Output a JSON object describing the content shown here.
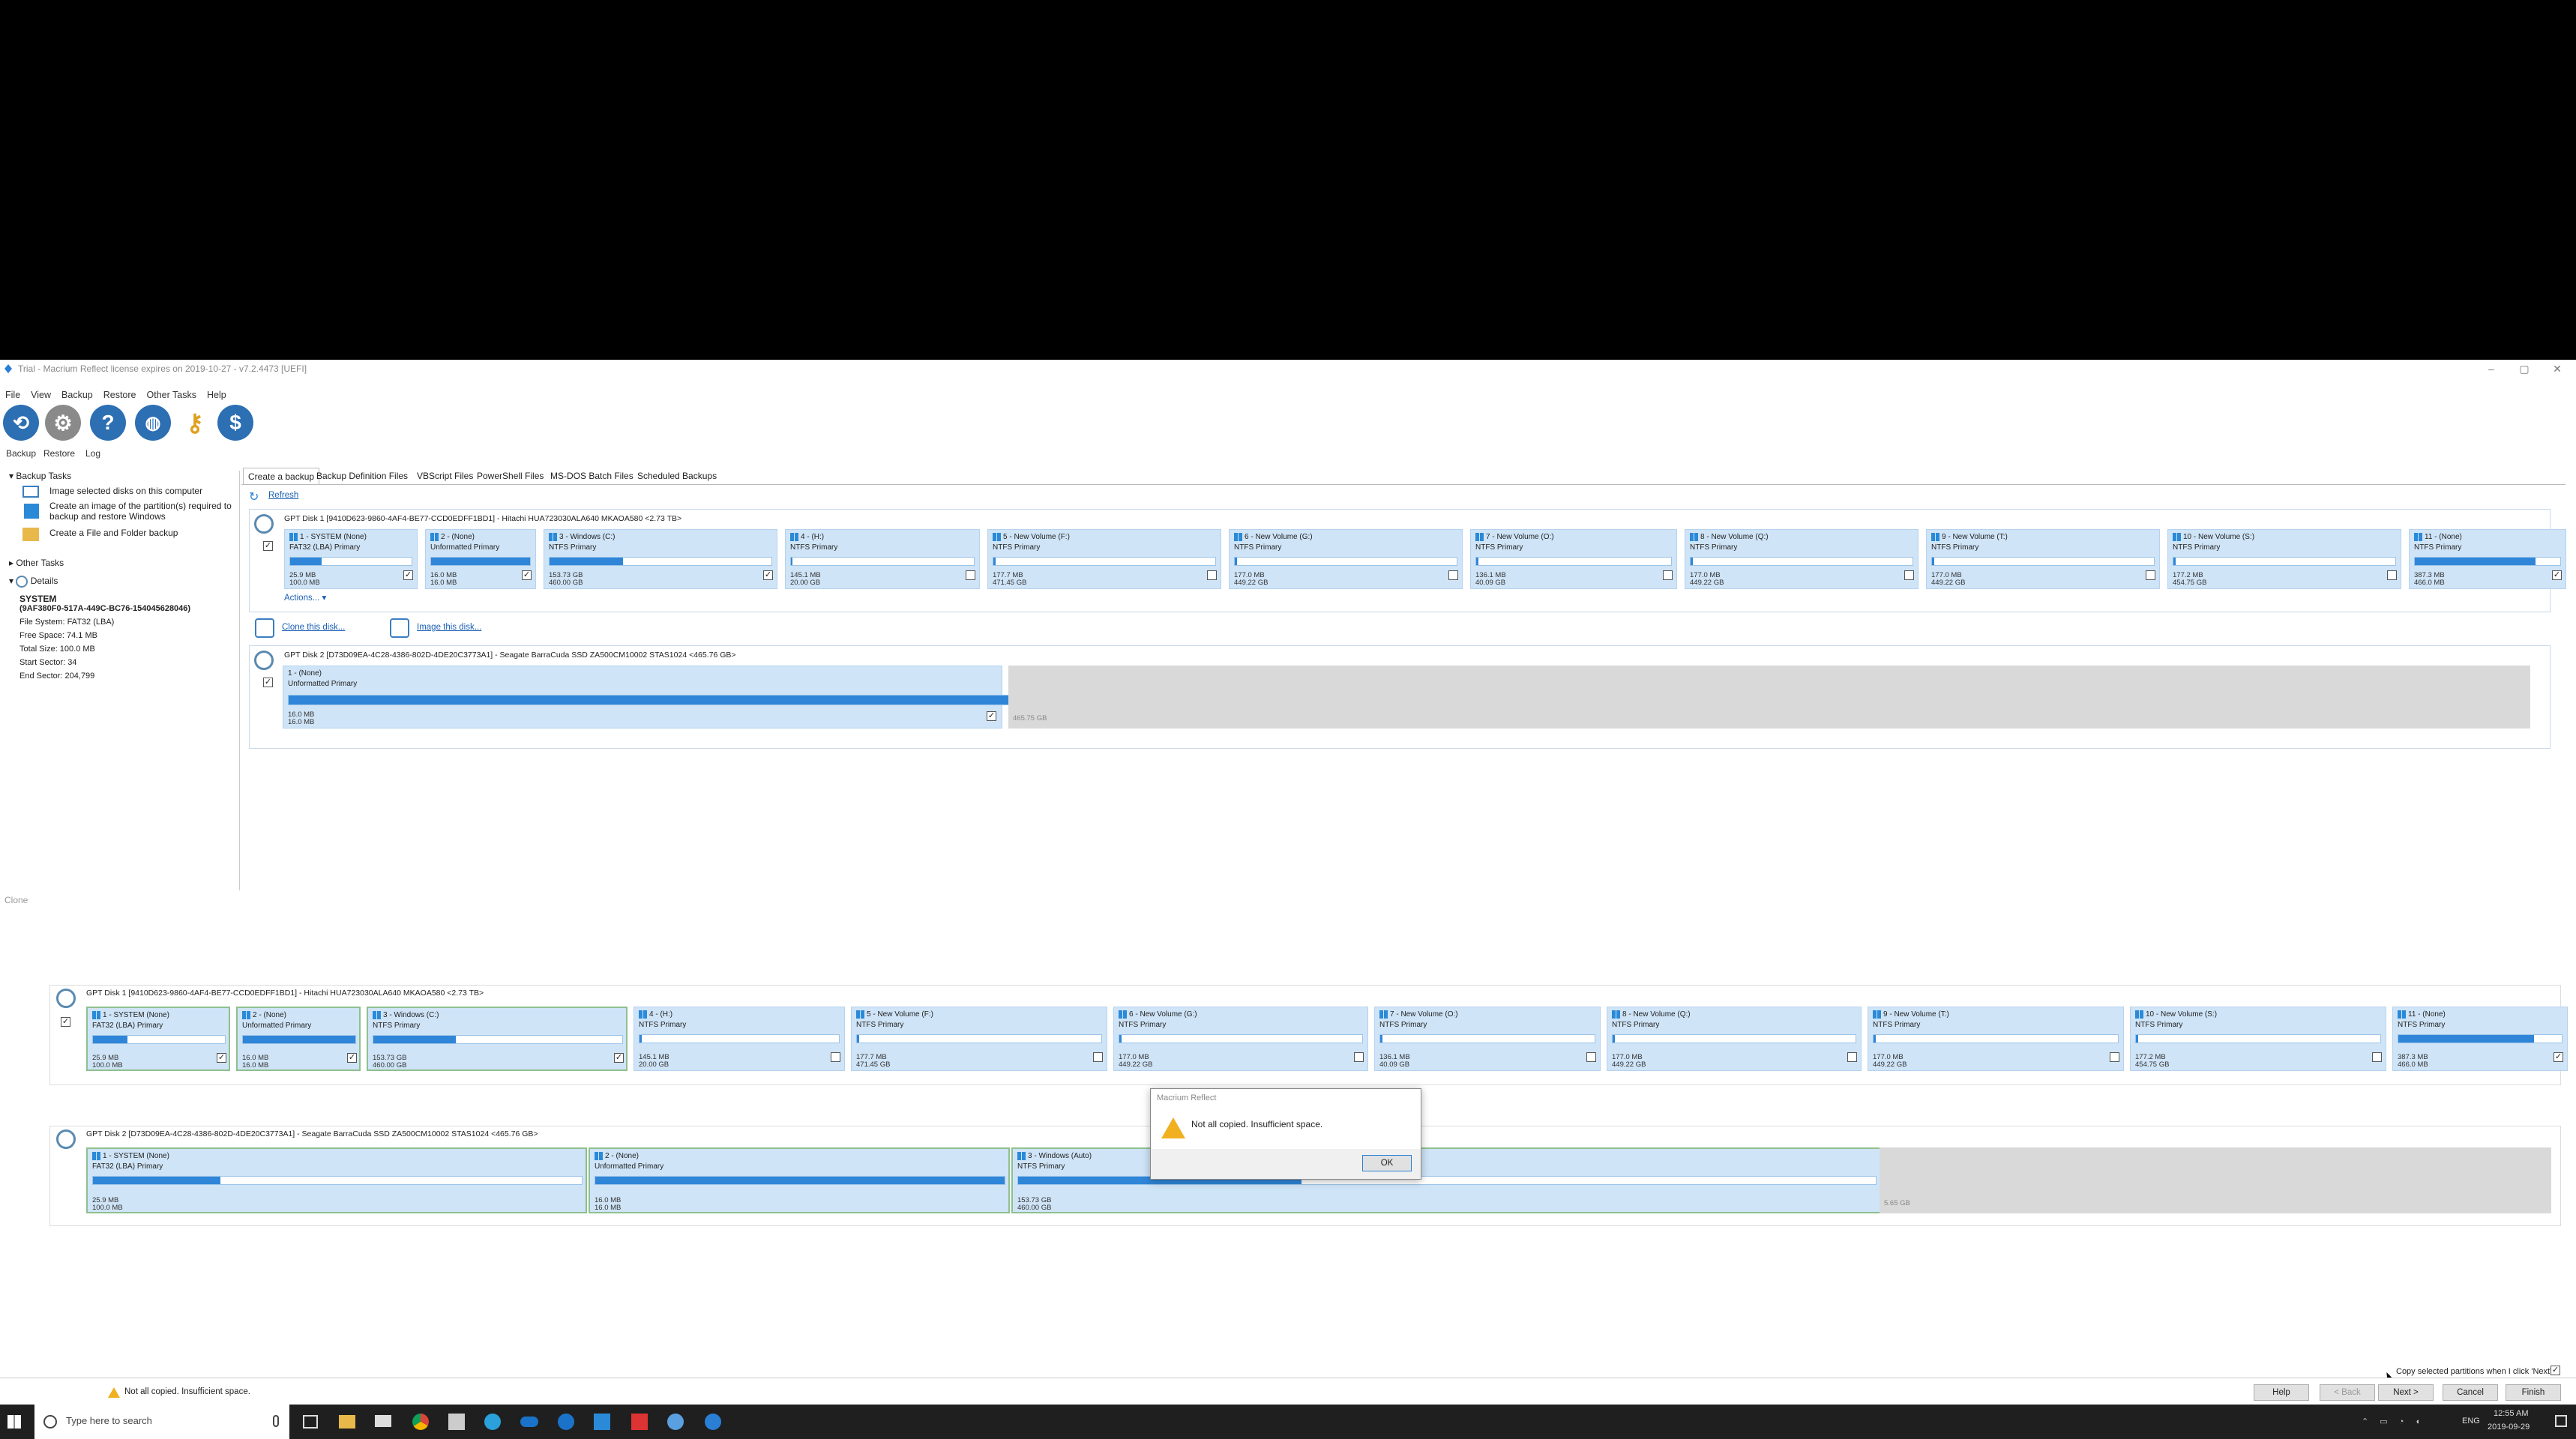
{
  "window": {
    "title": "Trial - Macrium Reflect license expires on 2019-10-27 - v7.2.4473 [UEFI]"
  },
  "menu": [
    "File",
    "View",
    "Backup",
    "Restore",
    "Other Tasks",
    "Help"
  ],
  "toolbar_labels": [
    "Backup",
    "Restore",
    "Log"
  ],
  "tabs": [
    "Create a backup",
    "Backup Definition Files",
    "VBScript Files",
    "PowerShell Files",
    "MS-DOS Batch Files",
    "Scheduled Backups"
  ],
  "left": {
    "backup_tasks": "Backup Tasks",
    "task1": "Image selected disks on this computer",
    "task2_l1": "Create an image of the partition(s) required to",
    "task2_l2": "backup and restore Windows",
    "task3": "Create a File and Folder backup",
    "other_tasks": "Other Tasks",
    "details": "Details",
    "d_name": "SYSTEM",
    "d_guid": "(9AF380F0-517A-449C-BC76-154045628046)",
    "d_fs": "File System:  FAT32 (LBA)",
    "d_free": "Free Space:    74.1 MB",
    "d_total": "Total Size:     100.0 MB",
    "d_start": "Start Sector:    34",
    "d_end": "End Sector:     204,799"
  },
  "main": {
    "refresh": "Refresh",
    "disk1_header": "GPT Disk 1 [9410D623-9860-4AF4-BE77-CCD0EDFF1BD1] - Hitachi HUA723030ALA640 MKAOA580  <2.73 TB>",
    "disk2_header": "GPT Disk 2 [D73D09EA-4C28-4386-802D-4DE20C3773A1] - Seagate BarraCuda SSD ZA500CM10002 STAS1024  <465.76 GB>",
    "actions": "Actions...",
    "clone_link": "Clone this disk...",
    "image_link": "Image this disk...",
    "d2p1_title": "1 - (None)",
    "d2p1_fs": "Unformatted Primary",
    "d2p1_s1": "16.0 MB",
    "d2p1_s2": "16.0 MB",
    "d2_unalloc": "465.75 GB"
  },
  "disk1_parts": [
    {
      "title": "1 - SYSTEM (None)",
      "fs": "FAT32 (LBA) Primary",
      "s1": "25.9 MB",
      "s2": "100.0 MB",
      "fill": 0.26,
      "checked": "✓"
    },
    {
      "title": "2 - (None)",
      "fs": "Unformatted Primary",
      "s1": "16.0 MB",
      "s2": "16.0 MB",
      "fill": 1.0,
      "checked": "✓"
    },
    {
      "title": "3 - Windows (C:)",
      "fs": "NTFS Primary",
      "s1": "153.73 GB",
      "s2": "460.00 GB",
      "fill": 0.33,
      "checked": "✓"
    },
    {
      "title": "4 - (H:)",
      "fs": "NTFS Primary",
      "s1": "145.1 MB",
      "s2": "20.00 GB",
      "fill": 0.01,
      "checked": ""
    },
    {
      "title": "5 - New Volume (F:)",
      "fs": "NTFS Primary",
      "s1": "177.7 MB",
      "s2": "471.45 GB",
      "fill": 0.01,
      "checked": ""
    },
    {
      "title": "6 - New Volume (G:)",
      "fs": "NTFS Primary",
      "s1": "177.0 MB",
      "s2": "449.22 GB",
      "fill": 0.01,
      "checked": ""
    },
    {
      "title": "7 - New Volume (O:)",
      "fs": "NTFS Primary",
      "s1": "136.1 MB",
      "s2": "40.09 GB",
      "fill": 0.01,
      "checked": ""
    },
    {
      "title": "8 - New Volume (Q:)",
      "fs": "NTFS Primary",
      "s1": "177.0 MB",
      "s2": "449.22 GB",
      "fill": 0.01,
      "checked": ""
    },
    {
      "title": "9 - New Volume (T:)",
      "fs": "NTFS Primary",
      "s1": "177.0 MB",
      "s2": "449.22 GB",
      "fill": 0.01,
      "checked": ""
    },
    {
      "title": "10 - New Volume (S:)",
      "fs": "NTFS Primary",
      "s1": "177.2 MB",
      "s2": "454.75 GB",
      "fill": 0.01,
      "checked": ""
    },
    {
      "title": "11 - (None)",
      "fs": "NTFS Primary",
      "s1": "387.3 MB",
      "s2": "466.0 MB",
      "fill": 0.83,
      "checked": "✓"
    }
  ],
  "clone": {
    "label": "Clone",
    "dst_header": "GPT Disk 2 [D73D09EA-4C28-4386-802D-4DE20C3773A1] - Seagate BarraCuda SSD ZA500CM10002 STAS1024  <465.76 GB>",
    "dst_parts": [
      {
        "title": "1 - SYSTEM (None)",
        "fs": "FAT32 (LBA) Primary",
        "s1": "25.9 MB",
        "s2": "100.0 MB",
        "fill": 0.26
      },
      {
        "title": "2 - (None)",
        "fs": "Unformatted Primary",
        "s1": "16.0 MB",
        "s2": "16.0 MB",
        "fill": 1.0
      },
      {
        "title": "3 - Windows (Auto)",
        "fs": "NTFS Primary",
        "s1": "153.73 GB",
        "s2": "460.00 GB",
        "fill": 0.33
      }
    ],
    "dst_unalloc": "5.65 GB",
    "copy_option": "Copy selected partitions when I click 'Next'",
    "status": "Not all copied. Insufficient space.",
    "btn_help": "Help",
    "btn_back": "< Back",
    "btn_next": "Next >",
    "btn_cancel": "Cancel",
    "btn_finish": "Finish"
  },
  "dialog": {
    "title": "Macrium Reflect",
    "message": "Not all copied. Insufficient space.",
    "ok": "OK"
  },
  "taskbar": {
    "search_placeholder": "Type here to search",
    "lang": "ENG",
    "time": "12:55 AM",
    "date": "2019-09-29"
  }
}
